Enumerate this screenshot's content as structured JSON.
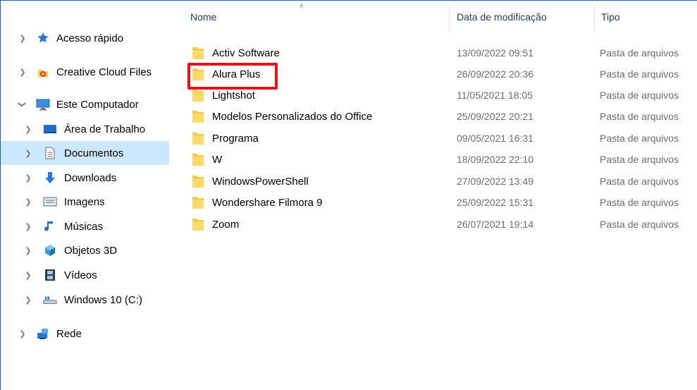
{
  "sidebar": {
    "items": [
      {
        "label": "Acesso rápido",
        "icon": "star-icon",
        "expanded": false
      },
      {
        "label": "Creative Cloud Files",
        "icon": "creative-cloud-icon",
        "expanded": false
      },
      {
        "label": "Este Computador",
        "icon": "computer-icon",
        "expanded": true
      },
      {
        "label": "Área de Trabalho",
        "icon": "desktop-icon",
        "expanded": false
      },
      {
        "label": "Documentos",
        "icon": "documents-icon",
        "expanded": false,
        "selected": true
      },
      {
        "label": "Downloads",
        "icon": "download-arrow-icon",
        "expanded": false
      },
      {
        "label": "Imagens",
        "icon": "pictures-icon",
        "expanded": false
      },
      {
        "label": "Músicas",
        "icon": "music-note-icon",
        "expanded": false
      },
      {
        "label": "Objetos 3D",
        "icon": "cube-3d-icon",
        "expanded": false
      },
      {
        "label": "Vídeos",
        "icon": "film-icon",
        "expanded": false
      },
      {
        "label": "Windows 10 (C:)",
        "icon": "drive-icon",
        "expanded": false
      },
      {
        "label": "Rede",
        "icon": "network-icon",
        "expanded": false
      }
    ]
  },
  "columns": {
    "name": "Nome",
    "date": "Data de modificação",
    "type": "Tipo"
  },
  "files": [
    {
      "name": "Activ Software",
      "date": "13/09/2022 09:51",
      "type": "Pasta de arquivos"
    },
    {
      "name": "Alura Plus",
      "date": "26/09/2022 20:36",
      "type": "Pasta de arquivos",
      "highlighted": true
    },
    {
      "name": "Lightshot",
      "date": "11/05/2021 18:05",
      "type": "Pasta de arquivos"
    },
    {
      "name": "Modelos Personalizados do Office",
      "date": "25/09/2022 20:21",
      "type": "Pasta de arquivos"
    },
    {
      "name": "Programa",
      "date": "09/05/2021 16:31",
      "type": "Pasta de arquivos"
    },
    {
      "name": "W",
      "date": "18/09/2022 22:10",
      "type": "Pasta de arquivos"
    },
    {
      "name": "WindowsPowerShell",
      "date": "27/09/2022 13:49",
      "type": "Pasta de arquivos"
    },
    {
      "name": "Wondershare Filmora 9",
      "date": "25/09/2022 15:31",
      "type": "Pasta de arquivos"
    },
    {
      "name": "Zoom",
      "date": "26/07/2021 19:14",
      "type": "Pasta de arquivos"
    }
  ],
  "colors": {
    "selection": "#cce8ff",
    "highlight": "#e0141e",
    "folder": "#f7c948"
  }
}
